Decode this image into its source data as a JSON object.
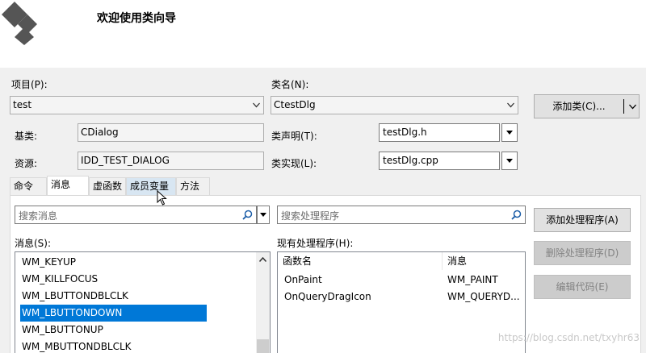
{
  "header": {
    "title": "欢迎使用类向导"
  },
  "project": {
    "label": "项目(P):",
    "value": "test"
  },
  "classname": {
    "label": "类名(N):",
    "value": "CtestDlg"
  },
  "add_class": {
    "label": "添加类(C)..."
  },
  "base": {
    "label": "基类:",
    "value": "CDialog"
  },
  "resource": {
    "label": "资源:",
    "value": "IDD_TEST_DIALOG"
  },
  "class_decl": {
    "label": "类声明(T):",
    "value": "testDlg.h"
  },
  "class_impl": {
    "label": "类实现(L):",
    "value": "testDlg.cpp"
  },
  "tabs": [
    {
      "label": "命令"
    },
    {
      "label": "消息"
    },
    {
      "label": "虚函数"
    },
    {
      "label": "成员变量"
    },
    {
      "label": "方法"
    }
  ],
  "search_messages": {
    "placeholder": "搜索消息"
  },
  "search_handlers": {
    "placeholder": "搜索处理程序"
  },
  "messages": {
    "label": "消息(S):",
    "items": [
      "WM_KEYUP",
      "WM_KILLFOCUS",
      "WM_LBUTTONDBLCLK",
      "WM_LBUTTONDOWN",
      "WM_LBUTTONUP",
      "WM_MBUTTONDBLCLK"
    ],
    "selected": "WM_LBUTTONDOWN"
  },
  "handlers": {
    "label": "现有处理程序(H):",
    "columns": [
      "函数名",
      "消息"
    ],
    "rows": [
      [
        "OnPaint",
        "WM_PAINT"
      ],
      [
        "OnQueryDragIcon",
        "WM_QUERYD..."
      ]
    ]
  },
  "buttons": {
    "add_handler": "添加处理程序(A)",
    "delete_handler": "删除处理程序(D)",
    "edit_code": "编辑代码(E)"
  },
  "watermark": "https://blog.csdn.net/txyhr63"
}
